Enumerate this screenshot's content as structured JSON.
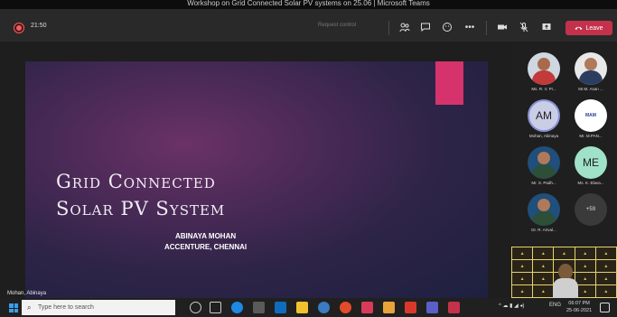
{
  "window": {
    "title": "Workshop on Grid Connected Solar PV systems on 25.06 | Microsoft Teams"
  },
  "toolbar": {
    "timer": "21:50",
    "request_control": "Request control",
    "leave_label": "Leave",
    "more_label": "•••",
    "icons": [
      "people-icon",
      "chat-icon",
      "reactions-icon",
      "more-icon",
      "camera-icon",
      "mic-off-icon",
      "share-icon",
      "phone-icon"
    ]
  },
  "slide": {
    "title_line1": "Grid Connected",
    "title_line2": "Solar PV System",
    "author": "ABINAYA MOHAN",
    "org": "ACCENTURE, CHENNAI",
    "accent_color": "#d6336c"
  },
  "presenter": {
    "name": "Mohan, Abinaya"
  },
  "participants": [
    {
      "label": "Ms. R. V. Pr...",
      "style": "female",
      "initials": ""
    },
    {
      "label": "Mr.M. Asan ...",
      "style": "male2",
      "initials": ""
    },
    {
      "label": "Mohan, Abinaya",
      "style": "am",
      "initials": "AM"
    },
    {
      "label": "Mr. M.PAN...",
      "style": "logo",
      "initials": "MAM"
    },
    {
      "label": "Mr. S. Padh...",
      "style": "plaque",
      "initials": ""
    },
    {
      "label": "Ms. K. Elava...",
      "style": "me",
      "initials": "ME"
    },
    {
      "label": "Dr. R. Arival...",
      "style": "plaque",
      "initials": ""
    },
    {
      "label": "",
      "style": "count",
      "initials": "+59"
    }
  ],
  "taskbar": {
    "search_placeholder": "Type here to search",
    "lang": "ENG",
    "time": "06:07 PM",
    "date": "25-06-2021"
  }
}
